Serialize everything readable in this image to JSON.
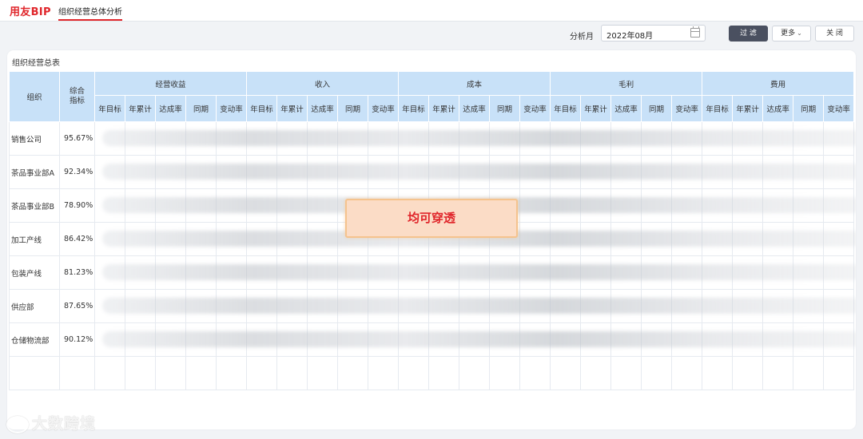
{
  "app": {
    "logo": "用友BIP",
    "active_tab": "组织经营总体分析"
  },
  "filter": {
    "label": "分析月",
    "month_value": "2022年08月",
    "filter_button": "过 滤",
    "more_button": "更多",
    "close_button": "关 闭"
  },
  "table": {
    "title": "组织经营总表",
    "col_org": "组织",
    "col_kpi": "综合\n指标",
    "groups": [
      "经营收益",
      "收入",
      "成本",
      "毛利",
      "费用"
    ],
    "subcols": [
      "年目标",
      "年累计",
      "达成率",
      "同期",
      "变动率"
    ],
    "rows": [
      {
        "org": "销售公司",
        "kpi": "95.67%"
      },
      {
        "org": "茶品事业部A",
        "kpi": "92.34%"
      },
      {
        "org": "茶品事业部B",
        "kpi": "78.90%"
      },
      {
        "org": "加工产线",
        "kpi": "86.42%"
      },
      {
        "org": "包装产线",
        "kpi": "81.23%"
      },
      {
        "org": "供应部",
        "kpi": "87.65%"
      },
      {
        "org": "仓储物流部",
        "kpi": "90.12%"
      }
    ]
  },
  "overlay_text": "均可穿透",
  "watermark": "大数跨境",
  "icons": {
    "calendar": "calendar-icon",
    "more": "chevron-down-icon",
    "watermark": "brand-logo-icon"
  }
}
